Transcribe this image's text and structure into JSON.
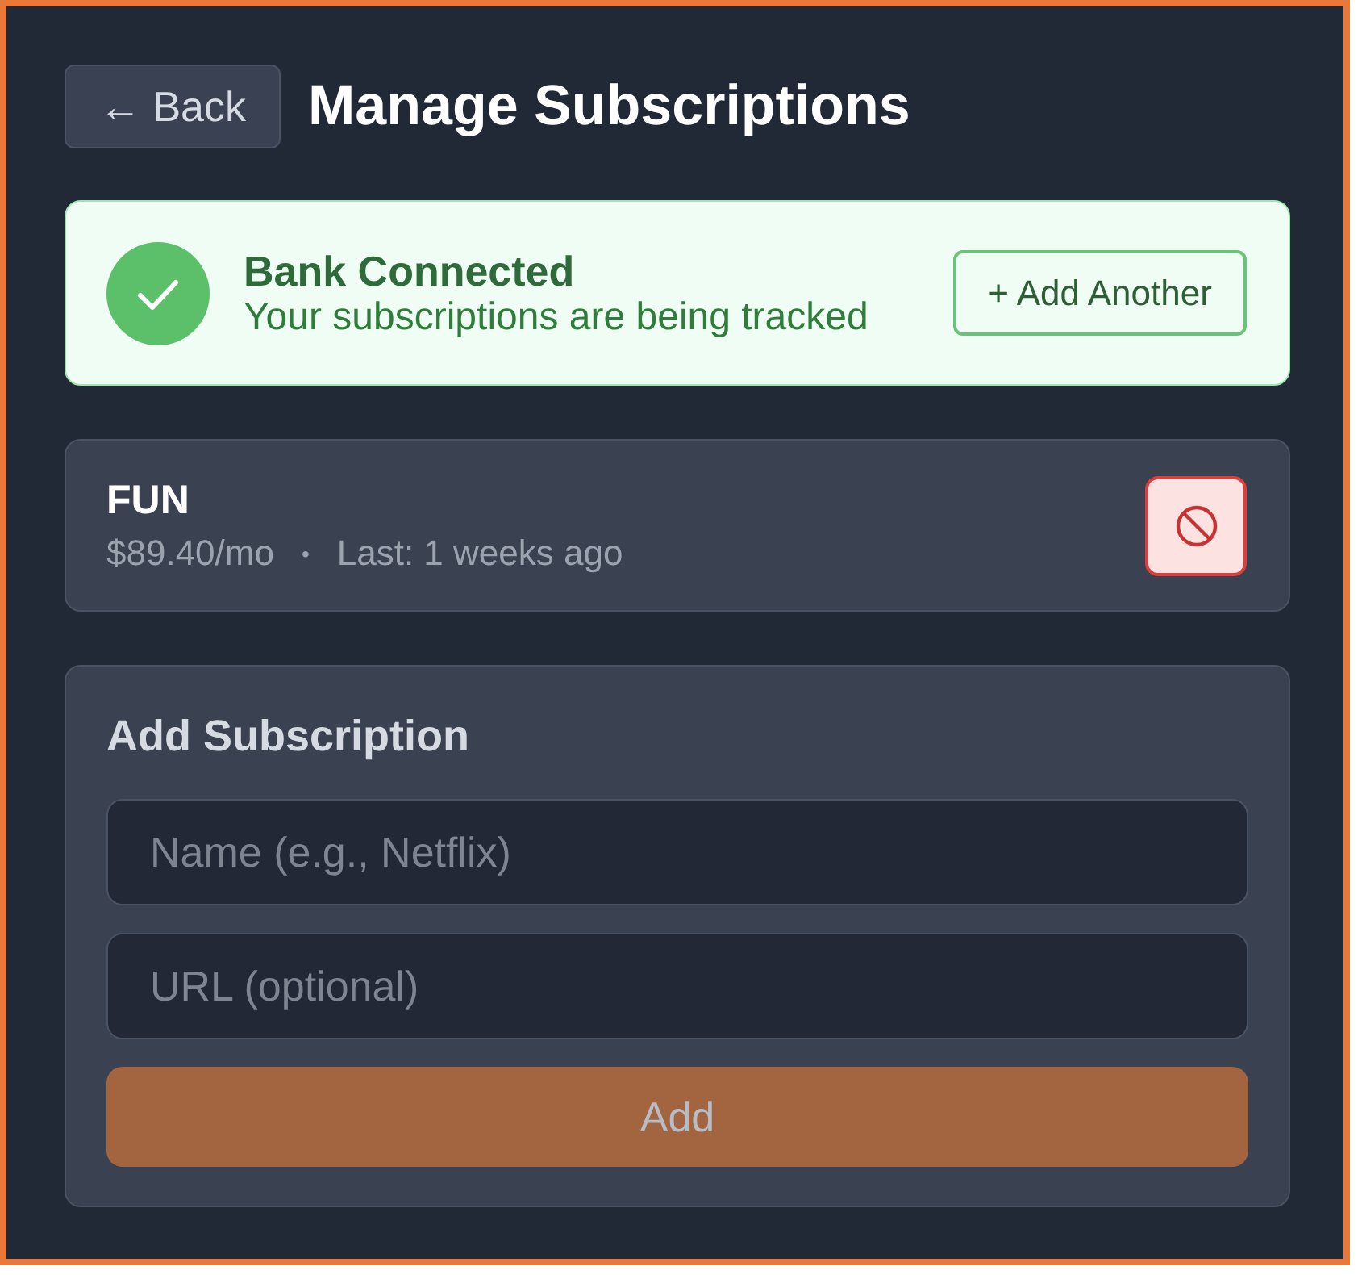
{
  "header": {
    "back_button": "← Back",
    "title": "Manage Subscriptions"
  },
  "bank_banner": {
    "title": "Bank Connected",
    "subtitle": "Your subscriptions are being tracked",
    "button": "+ Add Another"
  },
  "subscriptions": [
    {
      "name": "FUN",
      "price": "$89.40/mo",
      "separator": "•",
      "last_seen": "Last: 1 weeks ago"
    }
  ],
  "add_form": {
    "title": "Add Subscription",
    "fields": [
      {
        "placeholder": "Name (e.g., Netflix)"
      },
      {
        "placeholder": "URL (optional)"
      }
    ],
    "submit": {
      "label": "Add",
      "disabled": true
    }
  }
}
